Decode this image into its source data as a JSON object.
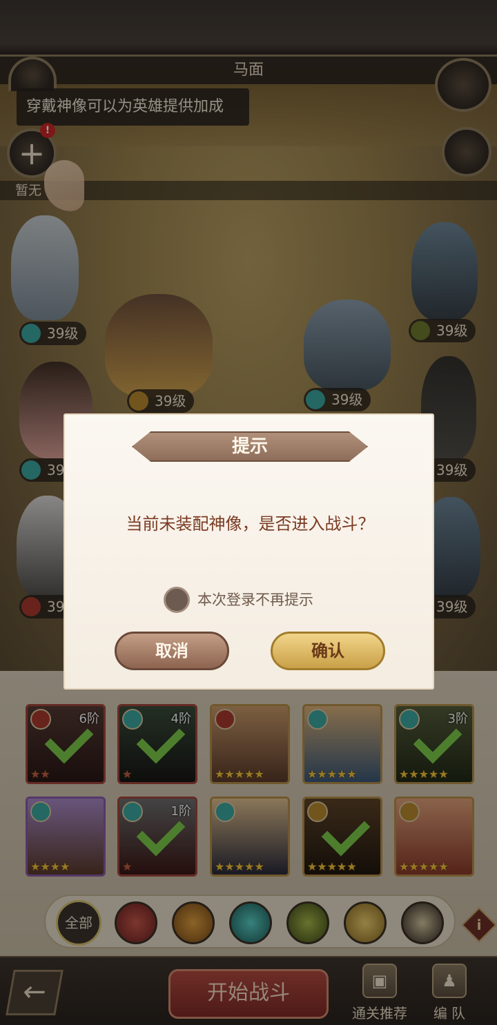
{
  "colors": {
    "faction_cyan": "#3aa6a0",
    "faction_gold": "#b98a2e",
    "faction_red": "#a83a2e",
    "faction_olive": "#6e7a2e",
    "card_purple": "#8a5aa8",
    "card_red": "#a4463c",
    "card_gold": "#b58e4a",
    "check_green": "#7ccc4a"
  },
  "header": {
    "title": "马面",
    "tooltip": "穿戴神像可以为英雄提供加成",
    "alert_badge": "!",
    "add_symbol": "+",
    "none_label": "暂无"
  },
  "arena": {
    "heroes": [
      {
        "level": "39级",
        "faction": "cyan-swirl-icon"
      },
      {
        "level": "39级",
        "faction": "gold-flame-icon"
      },
      {
        "level": "39级",
        "faction": "cyan-swirl-icon"
      },
      {
        "level": "39级",
        "faction": "olive-eye-icon"
      },
      {
        "level": "39",
        "faction": "cyan-swirl-icon"
      },
      {
        "level": "39级",
        "faction": "olive-eye-icon"
      },
      {
        "level": "39",
        "faction": "red-crest-icon"
      },
      {
        "level": "39级",
        "faction": "olive-eye-icon"
      }
    ]
  },
  "roster": {
    "cards": [
      {
        "rank": "6阶",
        "stars": "★★",
        "faction": "red-crest-icon",
        "checked": true
      },
      {
        "rank": "4阶",
        "stars": "★",
        "faction": "cyan-swirl-icon",
        "checked": true
      },
      {
        "rank": "",
        "stars": "★★★★★",
        "faction": "red-crest-icon",
        "checked": false
      },
      {
        "rank": "",
        "stars": "★★★★★",
        "faction": "cyan-swirl-icon",
        "checked": false
      },
      {
        "rank": "3阶",
        "stars": "★★★★★",
        "faction": "cyan-swirl-icon",
        "checked": true
      },
      {
        "rank": "",
        "stars": "★★★★",
        "faction": "cyan-swirl-icon",
        "checked": false
      },
      {
        "rank": "1阶",
        "stars": "★",
        "faction": "cyan-swirl-icon",
        "checked": true
      },
      {
        "rank": "",
        "stars": "★★★★★",
        "faction": "cyan-swirl-icon",
        "checked": false
      },
      {
        "rank": "",
        "stars": "★★★★★",
        "faction": "gold-flame-icon",
        "checked": true
      },
      {
        "rank": "",
        "stars": "★★★★★",
        "faction": "gold-flame-icon",
        "checked": false
      }
    ]
  },
  "filters": {
    "all_label": "全部",
    "info_symbol": "i"
  },
  "footer": {
    "back_symbol": "←",
    "start_label": "开始战斗",
    "recommend_label": "通关推荐",
    "team_label": "编  队"
  },
  "dialog": {
    "title": "提示",
    "message": "当前未装配神像，是否进入战斗？",
    "checkbox_label": "本次登录不再提示",
    "cancel_label": "取消",
    "confirm_label": "确认"
  }
}
